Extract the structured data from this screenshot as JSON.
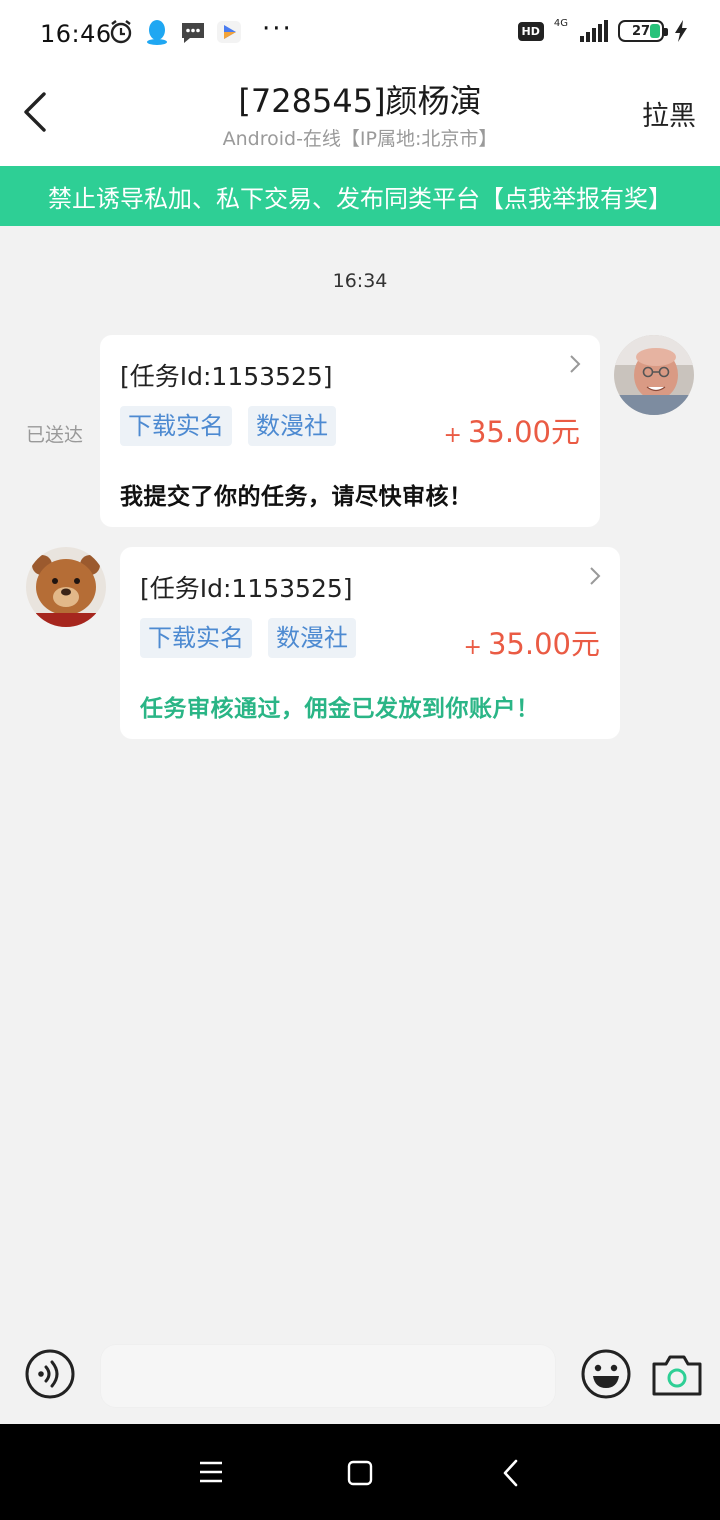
{
  "status_bar": {
    "time": "16:46",
    "icons": [
      "alarm-icon",
      "qq-icon",
      "message-icon",
      "video-app-icon"
    ],
    "more": "···",
    "hd": "HD",
    "network": "4G",
    "battery": "27"
  },
  "header": {
    "title": "[728545]颜杨演",
    "subtitle": "Android-在线【IP属地:北京市】",
    "block_label": "拉黑"
  },
  "banner": {
    "text": "禁止诱导私加、私下交易、发布同类平台【点我举报有奖】"
  },
  "chat": {
    "timestamp": "16:34",
    "messages": [
      {
        "side": "right",
        "status": "已送达",
        "task_id": "[任务Id:1153525]",
        "tags": [
          "下载实名",
          "数漫社"
        ],
        "reward_sign": "+",
        "reward": "35.00元",
        "text": "我提交了你的任务，请尽快审核！"
      },
      {
        "side": "left",
        "task_id": "[任务Id:1153525]",
        "tags": [
          "下载实名",
          "数漫社"
        ],
        "reward_sign": "+",
        "reward": "35.00元",
        "text": "任务审核通过，佣金已发放到你账户！"
      }
    ]
  },
  "input_bar": {
    "placeholder": ""
  },
  "colors": {
    "accent_green": "#2ecf95",
    "reward_red": "#ea5b44",
    "tag_blue": "#4d8ad1",
    "approved_green": "#2ab586"
  }
}
